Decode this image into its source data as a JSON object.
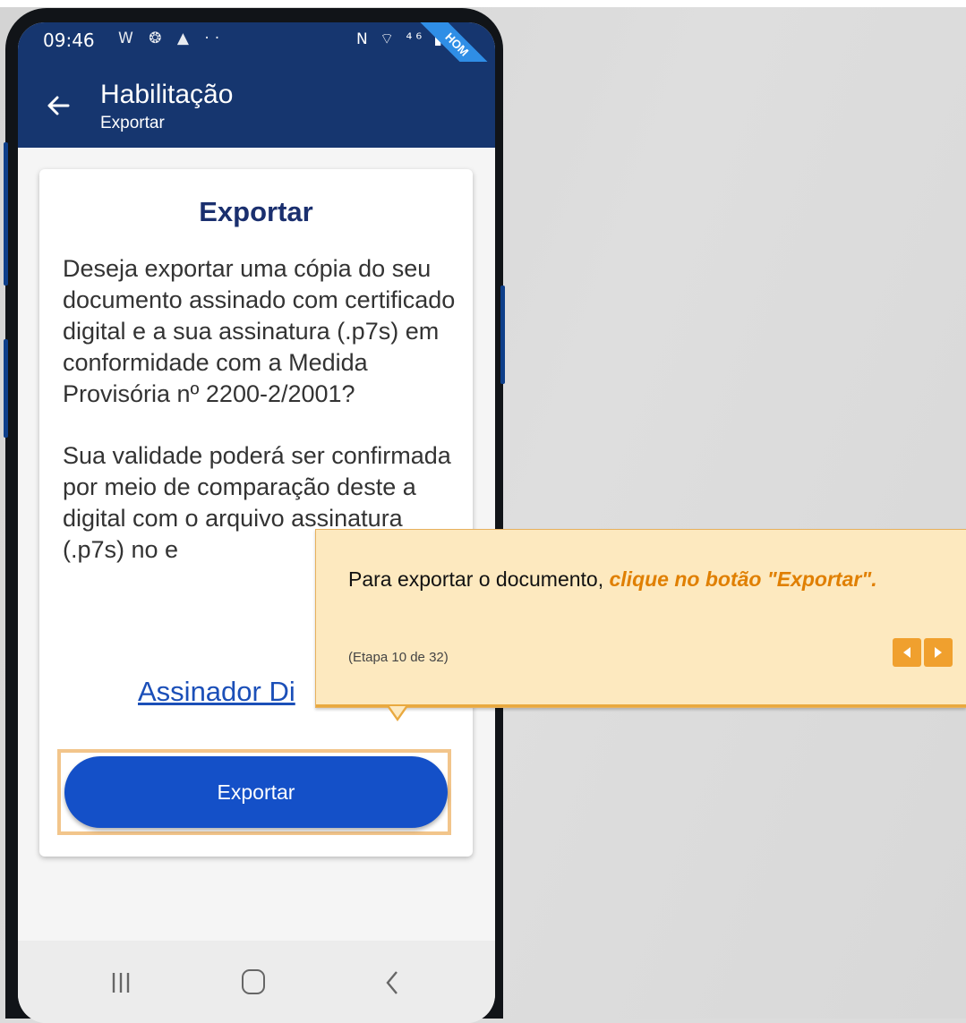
{
  "status_bar": {
    "time": "09:46",
    "notification_icons": "W ❂ ▲ ··",
    "system_icons": "N ⌔ ⁴⁶ ▮",
    "badge": "HOM"
  },
  "app_bar": {
    "title": "Habilitação",
    "subtitle": "Exportar"
  },
  "card": {
    "title": "Exportar",
    "paragraphs": [
      "Deseja exportar uma cópia do seu documento assinado com certificado digital e a sua assinatura (.p7s) em conformidade com a Medida Provisória nº 2200-2/2001?",
      "Sua validade poderá ser confirmada por meio de comparação deste a digital com o arquivo assinatura (.p7s) no e"
    ],
    "link_label": "Assinador Di",
    "button_label": "Exportar"
  },
  "tooltip": {
    "text_plain": "Para exportar o documento, ",
    "text_emphasis": "clique no botão \"Exportar\".",
    "step": "(Etapa 10 de 32)"
  },
  "colors": {
    "primary": "#16366f",
    "button": "#1450c8",
    "tooltip_bg": "#fde9bf",
    "tooltip_accent": "#e07f00"
  }
}
